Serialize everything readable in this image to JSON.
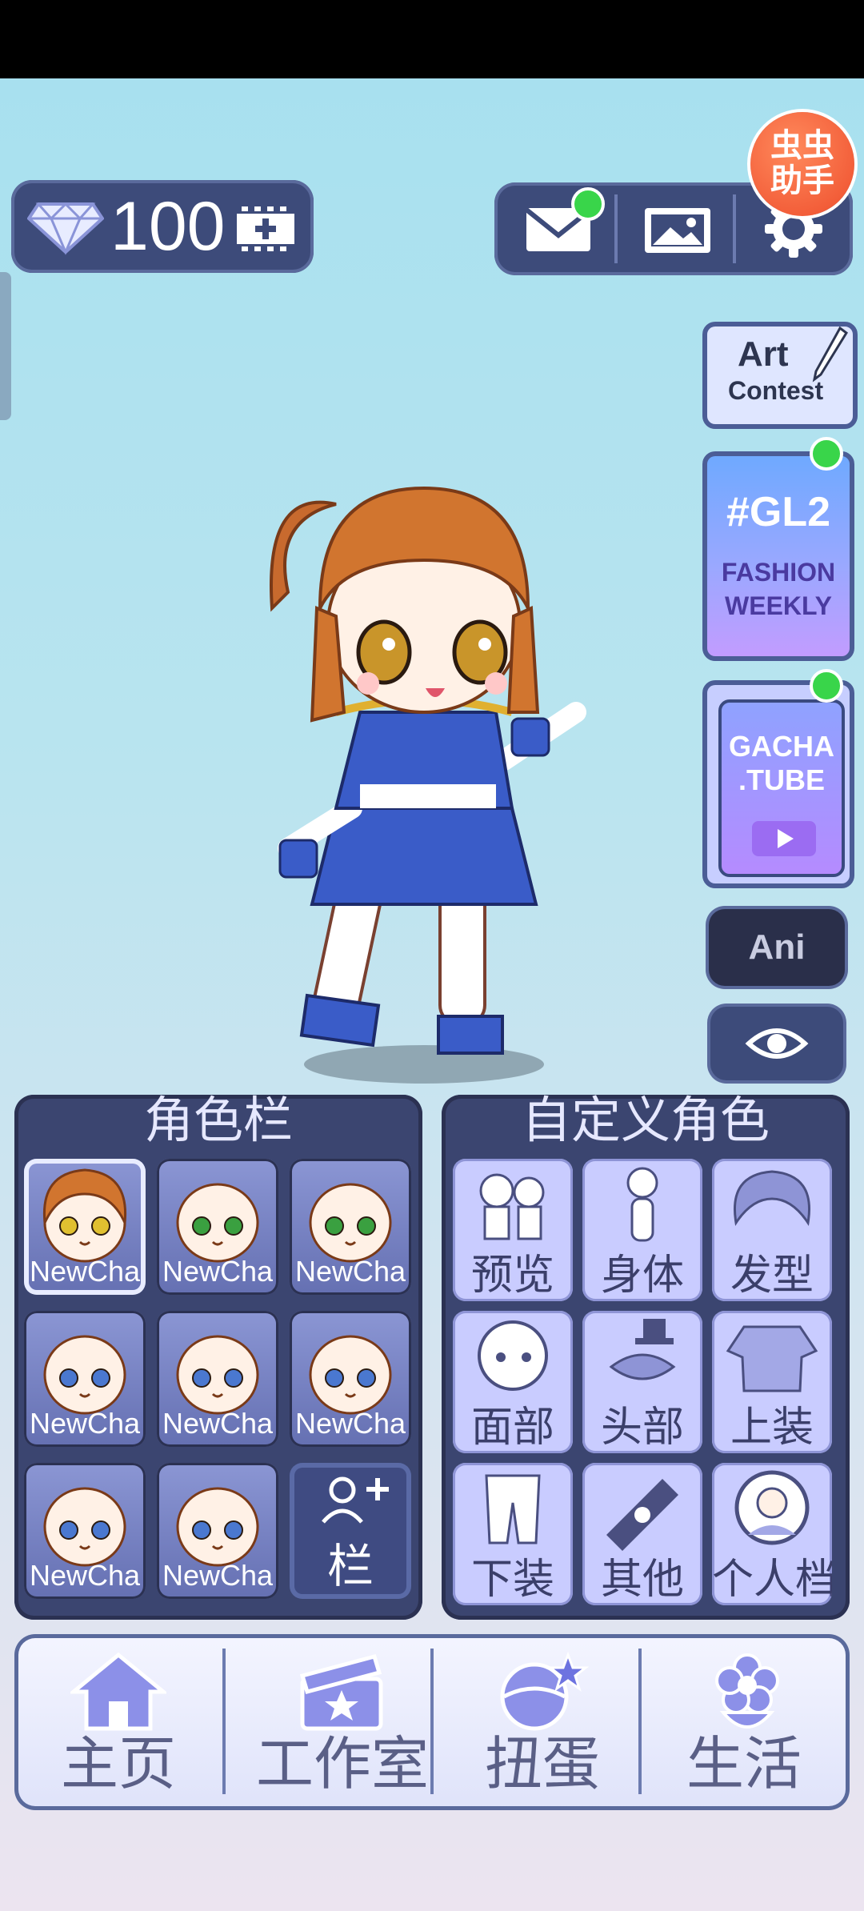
{
  "currency": {
    "gems": "100"
  },
  "helper_badge": {
    "line1": "虫虫",
    "line2": "助手"
  },
  "side": {
    "art_contest": {
      "line1": "Art",
      "line2": "Contest"
    },
    "gl2": {
      "title": "#GL2",
      "line1": "FASHION",
      "line2": "WEEKLY"
    },
    "gacha_tube": {
      "line1": "GACHA",
      "line2": ".TUBE"
    },
    "ani_label": "Ani"
  },
  "slots_panel": {
    "title": "角色栏",
    "slots": [
      {
        "name": "NewCha",
        "eye_color": "#e0c030"
      },
      {
        "name": "NewCha",
        "eye_color": "#3aa040"
      },
      {
        "name": "NewCha",
        "eye_color": "#3aa040"
      },
      {
        "name": "NewCha",
        "eye_color": "#4a78d0"
      },
      {
        "name": "NewCha",
        "eye_color": "#4a78d0"
      },
      {
        "name": "NewCha",
        "eye_color": "#4a78d0"
      },
      {
        "name": "NewCha",
        "eye_color": "#4a78d0"
      },
      {
        "name": "NewCha",
        "eye_color": "#4a78d0"
      }
    ],
    "add_slot_label": "栏"
  },
  "custom_panel": {
    "title": "自定义角色",
    "categories": [
      {
        "label": "预览",
        "icon": "preview-icon"
      },
      {
        "label": "身体",
        "icon": "body-icon"
      },
      {
        "label": "发型",
        "icon": "hair-icon"
      },
      {
        "label": "面部",
        "icon": "face-icon"
      },
      {
        "label": "头部",
        "icon": "head-accessory-icon"
      },
      {
        "label": "上装",
        "icon": "top-clothing-icon"
      },
      {
        "label": "下装",
        "icon": "bottom-clothing-icon"
      },
      {
        "label": "其他",
        "icon": "other-item-icon"
      },
      {
        "label": "个人档",
        "icon": "profile-icon"
      }
    ]
  },
  "nav": {
    "home": "主页",
    "studio": "工作室",
    "gacha": "扭蛋",
    "life": "生活"
  },
  "colors": {
    "panel": "#3b4570",
    "accent_green": "#39d54a",
    "category_bg": "#c9ccff"
  }
}
